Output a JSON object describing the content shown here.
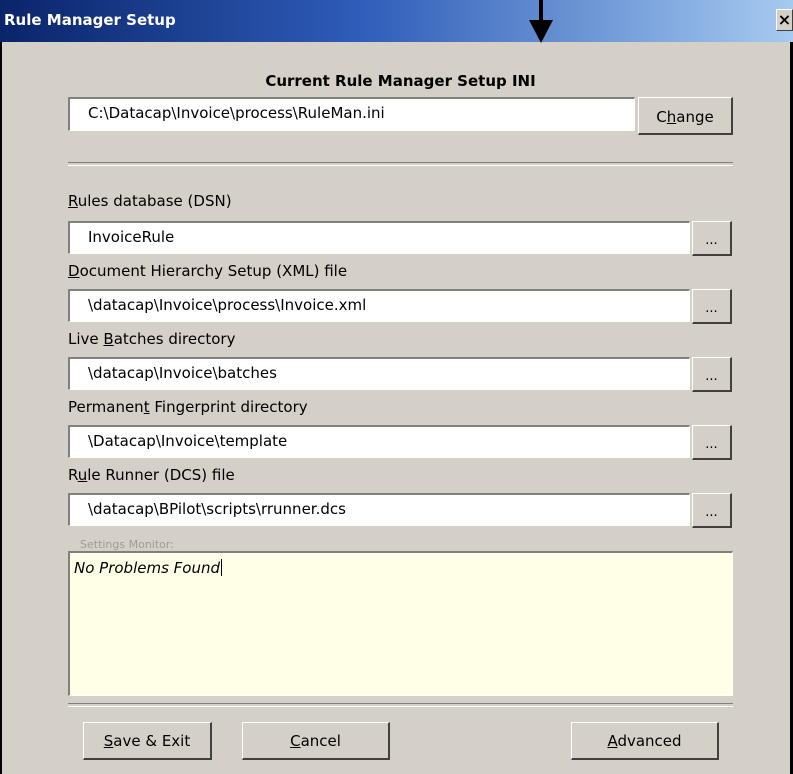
{
  "window": {
    "title": "Rule Manager Setup",
    "close_glyph": "×",
    "close_icon": "close-icon",
    "pointer_icon": "down-arrow-icon"
  },
  "ini": {
    "heading": "Current Rule Manager Setup INI",
    "path": "C:\\Datacap\\Invoice\\process\\RuleMan.ini",
    "change_button": {
      "pre": "C",
      "mnemonic": "h",
      "post": "ange"
    }
  },
  "fields": [
    {
      "label_pre": "",
      "mnemonic": "R",
      "label_post": "ules database (DSN)",
      "value": "InvoiceRule",
      "browse": "..."
    },
    {
      "label_pre": "",
      "mnemonic": "D",
      "label_post": "ocument Hierarchy Setup (XML) file",
      "value": "\\datacap\\Invoice\\process\\Invoice.xml",
      "browse": "..."
    },
    {
      "label_pre": "Live ",
      "mnemonic": "B",
      "label_post": "atches directory",
      "value": "\\datacap\\Invoice\\batches",
      "browse": "..."
    },
    {
      "label_pre": "Permanen",
      "mnemonic": "t",
      "label_post": " Fingerprint directory",
      "value": "\\Datacap\\Invoice\\template",
      "browse": "..."
    },
    {
      "label_pre": "R",
      "mnemonic": "u",
      "label_post": "le Runner (DCS) file",
      "value": "\\datacap\\BPilot\\scripts\\rrunner.dcs",
      "browse": "..."
    }
  ],
  "monitor": {
    "label": "Settings Monitor:",
    "text": "No Problems Found"
  },
  "buttons": {
    "save": {
      "mnemonic": "S",
      "post": "ave & Exit"
    },
    "cancel": {
      "mnemonic": "C",
      "post": "ancel"
    },
    "advanced": {
      "mnemonic": "A",
      "post": "dvanced"
    }
  },
  "colors": {
    "face": "#d4d0c8",
    "titlebar_start": "#0a246a",
    "titlebar_end": "#a6caf0",
    "monitor_bg": "#ffffe8"
  }
}
